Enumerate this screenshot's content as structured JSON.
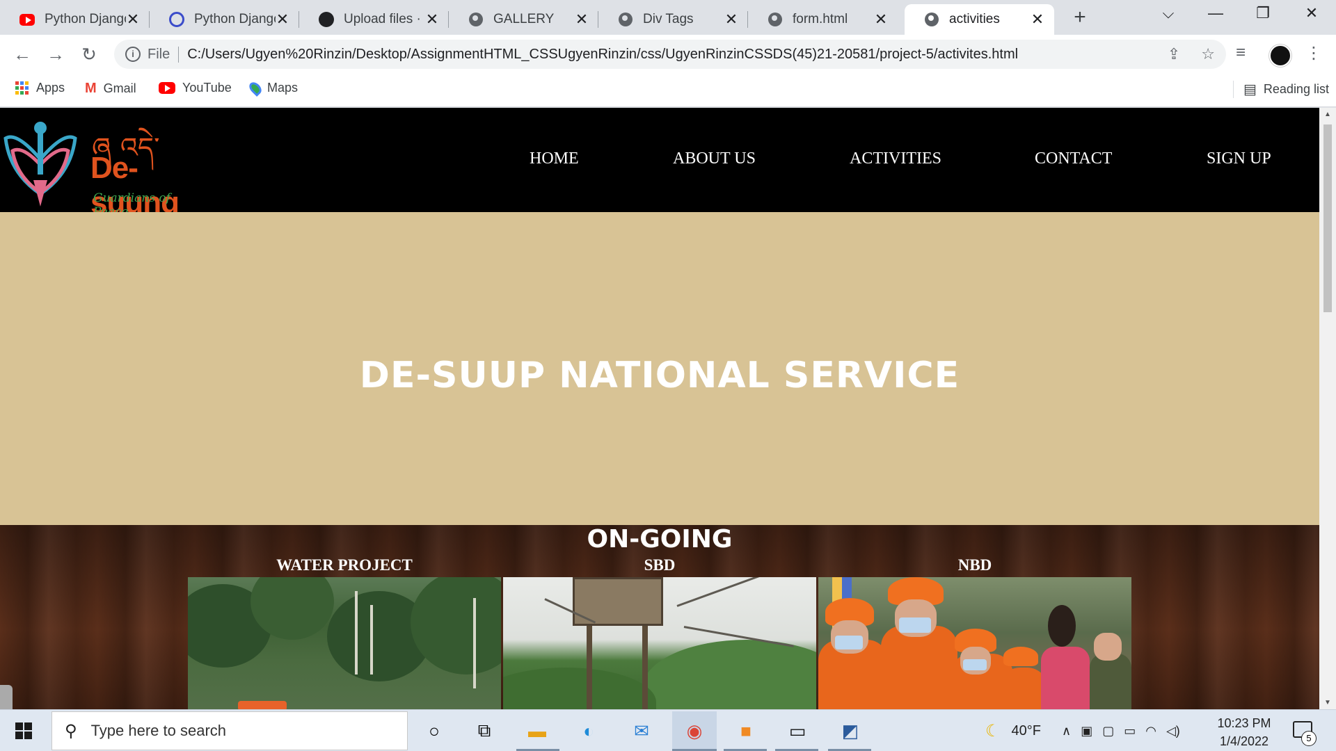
{
  "browser": {
    "tabs": [
      {
        "title": "Python Django",
        "favicon": "youtube-icon",
        "active": false
      },
      {
        "title": "Python Django",
        "favicon": "django-icon",
        "active": false
      },
      {
        "title": "Upload files · U",
        "favicon": "github-icon",
        "active": false
      },
      {
        "title": "GALLERY",
        "favicon": "globe-icon",
        "active": false
      },
      {
        "title": "Div Tags",
        "favicon": "globe-icon",
        "active": false
      },
      {
        "title": "form.html",
        "favicon": "globe-icon",
        "active": false
      },
      {
        "title": "activities",
        "favicon": "globe-icon",
        "active": true
      }
    ],
    "new_tab": "+",
    "close_glyph": "✕",
    "window_controls": {
      "tab_search": "⌵",
      "minimize": "—",
      "restore": "❐",
      "close": "✕"
    },
    "nav": {
      "back": "←",
      "forward": "→",
      "reload": "↻"
    },
    "address": {
      "info": "i",
      "scheme_label": "File",
      "url": "C:/Users/Ugyen%20Rinzin/Desktop/AssignmentHTML_CSSUgyenRinzin/css/UgyenRinzinCSSDS(45)21-20581/project-5/activites.html"
    },
    "bookmarks": [
      {
        "label": "Apps",
        "icon": "apps-grid-icon"
      },
      {
        "label": "Gmail",
        "icon": "gmail-icon"
      },
      {
        "label": "YouTube",
        "icon": "youtube-icon"
      },
      {
        "label": "Maps",
        "icon": "maps-pin-icon"
      }
    ],
    "reading_list": "Reading list"
  },
  "site": {
    "logo": {
      "script": "ཞ འདེ་སྲུང་།",
      "name": "De-suung",
      "tagline": "Guardians of Peace"
    },
    "nav": [
      "HOME",
      "ABOUT US",
      "ACTIVITIES",
      "CONTACT",
      "SIGN UP"
    ],
    "hero_title": "DE-SUUP NATIONAL SERVICE",
    "ongoing": {
      "title": "ON-GOING",
      "cards": [
        {
          "label": "WATER PROJECT"
        },
        {
          "label": "SBD"
        },
        {
          "label": "NBD"
        }
      ]
    },
    "colors": {
      "header_bg": "#000000",
      "hero_bg": "#d8c395",
      "logo_accent": "#e0531e"
    }
  },
  "taskbar": {
    "search_placeholder": "Type here to search",
    "apps": [
      "cortana-icon",
      "task-view-icon",
      "file-explorer-icon",
      "edge-icon",
      "mail-icon",
      "chrome-icon",
      "sublime-text-icon",
      "terminal-icon",
      "app-icon"
    ],
    "weather": "40°F",
    "time": "10:23 PM",
    "date": "1/4/2022",
    "notifications": "5"
  }
}
